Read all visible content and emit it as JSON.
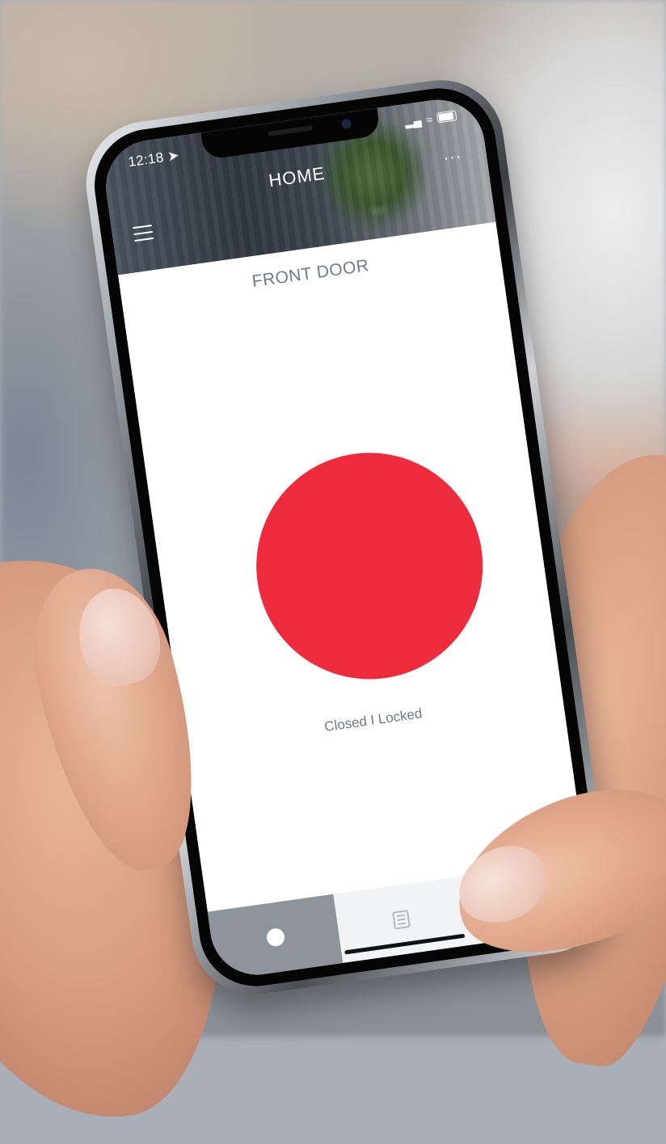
{
  "status_bar": {
    "time": "12:18"
  },
  "header": {
    "title": "HOME",
    "more_label": "..."
  },
  "lock": {
    "name": "FRONT DOOR",
    "status": "Closed I Locked",
    "status_color": "#ee2a3d"
  },
  "tabs": [
    {
      "icon": "lock-dot-icon",
      "active": true
    },
    {
      "icon": "list-icon",
      "active": false
    }
  ]
}
